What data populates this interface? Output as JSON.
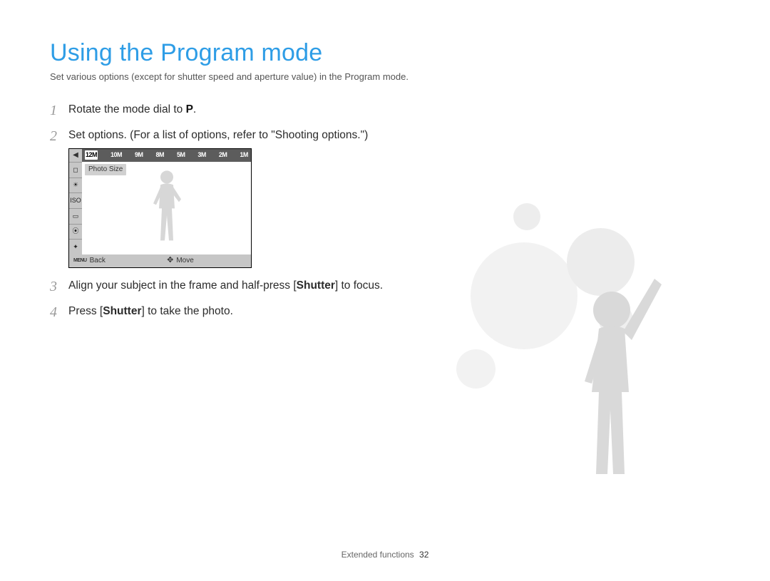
{
  "title": "Using the Program mode",
  "subtitle": "Set various options (except for shutter speed and aperture value) in the Program mode.",
  "steps": {
    "s1": {
      "num": "1",
      "pre": "Rotate the mode dial to ",
      "glyph": "P",
      "post": "."
    },
    "s2": {
      "num": "2",
      "text": "Set options. (For a list of options, refer to \"Shooting options.\")"
    },
    "s3": {
      "num": "3",
      "pre": "Align your subject in the frame and half-press [",
      "bold": "Shutter",
      "post": "] to focus."
    },
    "s4": {
      "num": "4",
      "pre": "Press [",
      "bold": "Shutter",
      "post": "] to take the photo."
    }
  },
  "lcd": {
    "sizes": [
      "12M",
      "10M",
      "9M",
      "8M",
      "5M",
      "3M",
      "2M",
      "1M"
    ],
    "label": "Photo Size",
    "side_icons": [
      "◻",
      "☀",
      "ISO",
      "▭",
      "⦿",
      "✦"
    ],
    "bottom": {
      "back_glyph": "MENU",
      "back": "Back",
      "move_glyph": "✥",
      "move": "Move"
    }
  },
  "footer": {
    "section": "Extended functions",
    "page": "32"
  }
}
